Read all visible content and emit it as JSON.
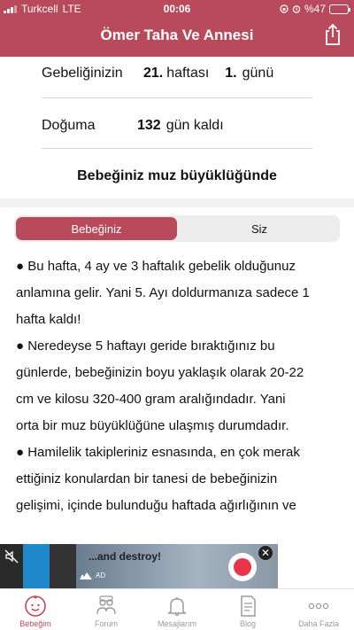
{
  "status_bar": {
    "carrier": "Turkcell",
    "network": "LTE",
    "time": "00:06",
    "battery": "%47",
    "battery_level": 0.47
  },
  "header": {
    "title": "Ömer Taha  Ve Annesi"
  },
  "pregnancy": {
    "label": "Gebeliğinizin",
    "week": "21.",
    "week_unit": "haftası",
    "day": "1.",
    "day_unit": "günü"
  },
  "birth": {
    "label": "Doğuma",
    "days": "132",
    "suffix": "gün kaldı"
  },
  "headline": "Bebeğiniz muz büyüklüğünde",
  "segments": {
    "baby": "Bebeğiniz",
    "you": "Siz"
  },
  "content": {
    "lines": [
      "● Bu hafta, 4 ay ve 3 haftalık gebelik olduğunuz",
      "anlamına gelir. Yani 5. Ayı doldurmanıza sadece 1",
      "hafta kaldı!",
      "● Neredeyse 5 haftayı geride bıraktığınız bu",
      "günlerde, bebeğinizin boyu yaklaşık olarak 20-22",
      "cm ve kilosu 320-400 gram aralığındadır. Yani",
      "orta bir muz büyüklüğüne ulaşmış durumdadır.",
      "● Hamilelik takipleriniz esnasında, en çok merak",
      "ettiğiniz konulardan bir tanesi de bebeğinizin",
      "gelişimi, içinde bulunduğu haftada ağırlığının ve"
    ]
  },
  "ad": {
    "text": "...and destroy!",
    "tag": "AD",
    "close": "✕"
  },
  "tabs": [
    {
      "label": "Bebeğim",
      "icon": "baby-face-icon"
    },
    {
      "label": "Forum",
      "icon": "forum-icon"
    },
    {
      "label": "Mesajlarım",
      "icon": "bell-icon"
    },
    {
      "label": "Blog",
      "icon": "blog-icon"
    },
    {
      "label": "Daha Fazla",
      "icon": "more-icon"
    }
  ],
  "colors": {
    "accent": "#b84a5b"
  }
}
